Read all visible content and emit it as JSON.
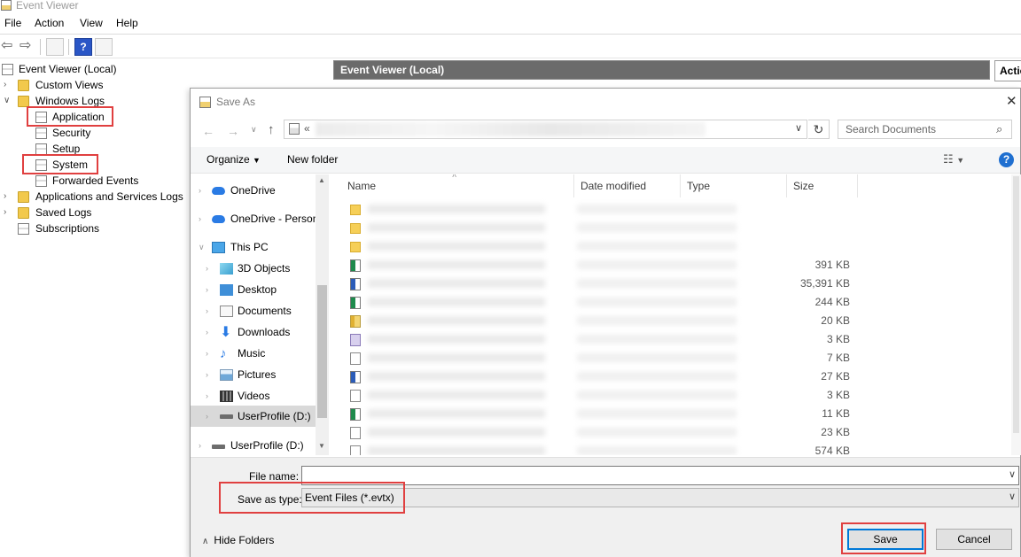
{
  "window": {
    "title": "Event Viewer"
  },
  "menu": [
    "File",
    "Action",
    "View",
    "Help"
  ],
  "tree": {
    "root": "Event Viewer (Local)",
    "custom_views": "Custom Views",
    "windows_logs": "Windows Logs",
    "application": "Application",
    "security": "Security",
    "setup": "Setup",
    "system": "System",
    "forwarded": "Forwarded Events",
    "app_services": "Applications and Services Logs",
    "saved_logs": "Saved Logs",
    "subscriptions": "Subscriptions"
  },
  "center_header": "Event Viewer (Local)",
  "actions_header": "Actic",
  "dialog": {
    "title": "Save As",
    "breadcrumb_prefix": "«",
    "search_placeholder": "Search Documents",
    "organize": "Organize",
    "new_folder": "New folder",
    "help": "?",
    "nav": [
      {
        "label": "OneDrive",
        "icon": "onedrive-icon"
      },
      {
        "label": "OneDrive - Person",
        "icon": "onedrive-icon"
      },
      {
        "label": "This PC",
        "icon": "this-pc-icon"
      },
      {
        "label": "3D Objects",
        "icon": "3d-objects-icon"
      },
      {
        "label": "Desktop",
        "icon": "desktop-icon"
      },
      {
        "label": "Documents",
        "icon": "documents-icon"
      },
      {
        "label": "Downloads",
        "icon": "downloads-icon"
      },
      {
        "label": "Music",
        "icon": "music-icon"
      },
      {
        "label": "Pictures",
        "icon": "pictures-icon"
      },
      {
        "label": "Videos",
        "icon": "videos-icon"
      },
      {
        "label": "UserProfile (D:)",
        "icon": "drive-icon"
      },
      {
        "label": "UserProfile (D:)",
        "icon": "drive-icon"
      }
    ],
    "columns": [
      "Name",
      "Date modified",
      "Type",
      "Size"
    ],
    "files": [
      {
        "icon": "folder",
        "size": ""
      },
      {
        "icon": "folder",
        "size": ""
      },
      {
        "icon": "folder",
        "size": ""
      },
      {
        "icon": "excel",
        "size": "391 KB"
      },
      {
        "icon": "word",
        "size": "35,391 KB"
      },
      {
        "icon": "excel",
        "size": "244 KB"
      },
      {
        "icon": "zip",
        "size": "20 KB"
      },
      {
        "icon": "config",
        "size": "3 KB"
      },
      {
        "icon": "text",
        "size": "7 KB"
      },
      {
        "icon": "word",
        "size": "27 KB"
      },
      {
        "icon": "text",
        "size": "3 KB"
      },
      {
        "icon": "excel",
        "size": "11 KB"
      },
      {
        "icon": "text",
        "size": "23 KB"
      },
      {
        "icon": "text",
        "size": "574 KB"
      }
    ],
    "file_name_label": "File name:",
    "file_name_value": "",
    "save_type_label": "Save as type:",
    "save_type_value": "Event Files (*.evtx)",
    "hide_folders": "Hide Folders",
    "save": "Save",
    "cancel": "Cancel"
  }
}
